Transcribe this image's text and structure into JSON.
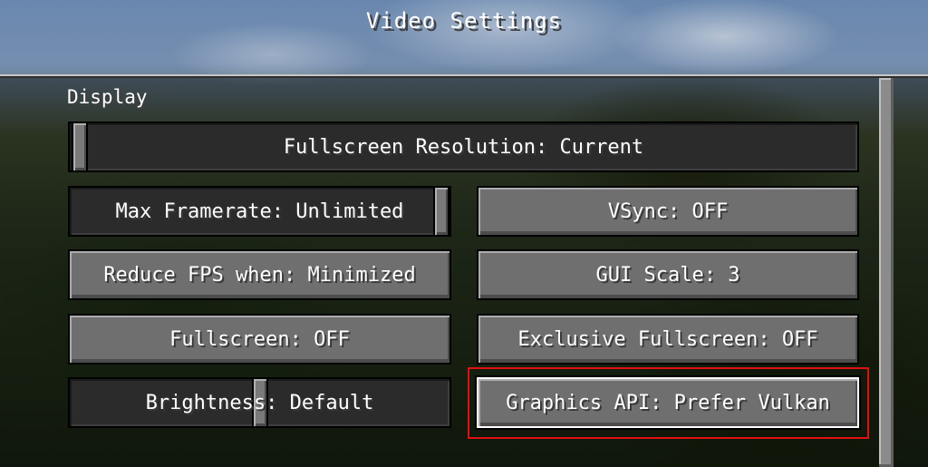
{
  "screen": {
    "title": "Video Settings",
    "section_label": "Display"
  },
  "options": {
    "fullscreen_resolution": {
      "label": "Fullscreen Resolution: Current",
      "type": "slider",
      "level": 0.0
    },
    "max_framerate": {
      "label": "Max Framerate: Unlimited",
      "type": "slider",
      "level": 1.0
    },
    "vsync": {
      "label": "VSync: OFF",
      "type": "button"
    },
    "reduce_fps": {
      "label": "Reduce FPS when: Minimized",
      "type": "button"
    },
    "gui_scale": {
      "label": "GUI Scale: 3",
      "type": "button"
    },
    "fullscreen": {
      "label": "Fullscreen: OFF",
      "type": "button"
    },
    "exclusive_fullscreen": {
      "label": "Exclusive Fullscreen: OFF",
      "type": "button"
    },
    "brightness": {
      "label": "Brightness: Default",
      "type": "slider",
      "level": 0.5
    },
    "graphics_api": {
      "label": "Graphics API: Prefer Vulkan",
      "type": "button",
      "focused": true,
      "highlighted": true
    }
  },
  "colors": {
    "highlight": "#e01010",
    "button_face": "#6f6f6f",
    "slider_track": "#2b2b2b",
    "text": "#ffffff"
  }
}
